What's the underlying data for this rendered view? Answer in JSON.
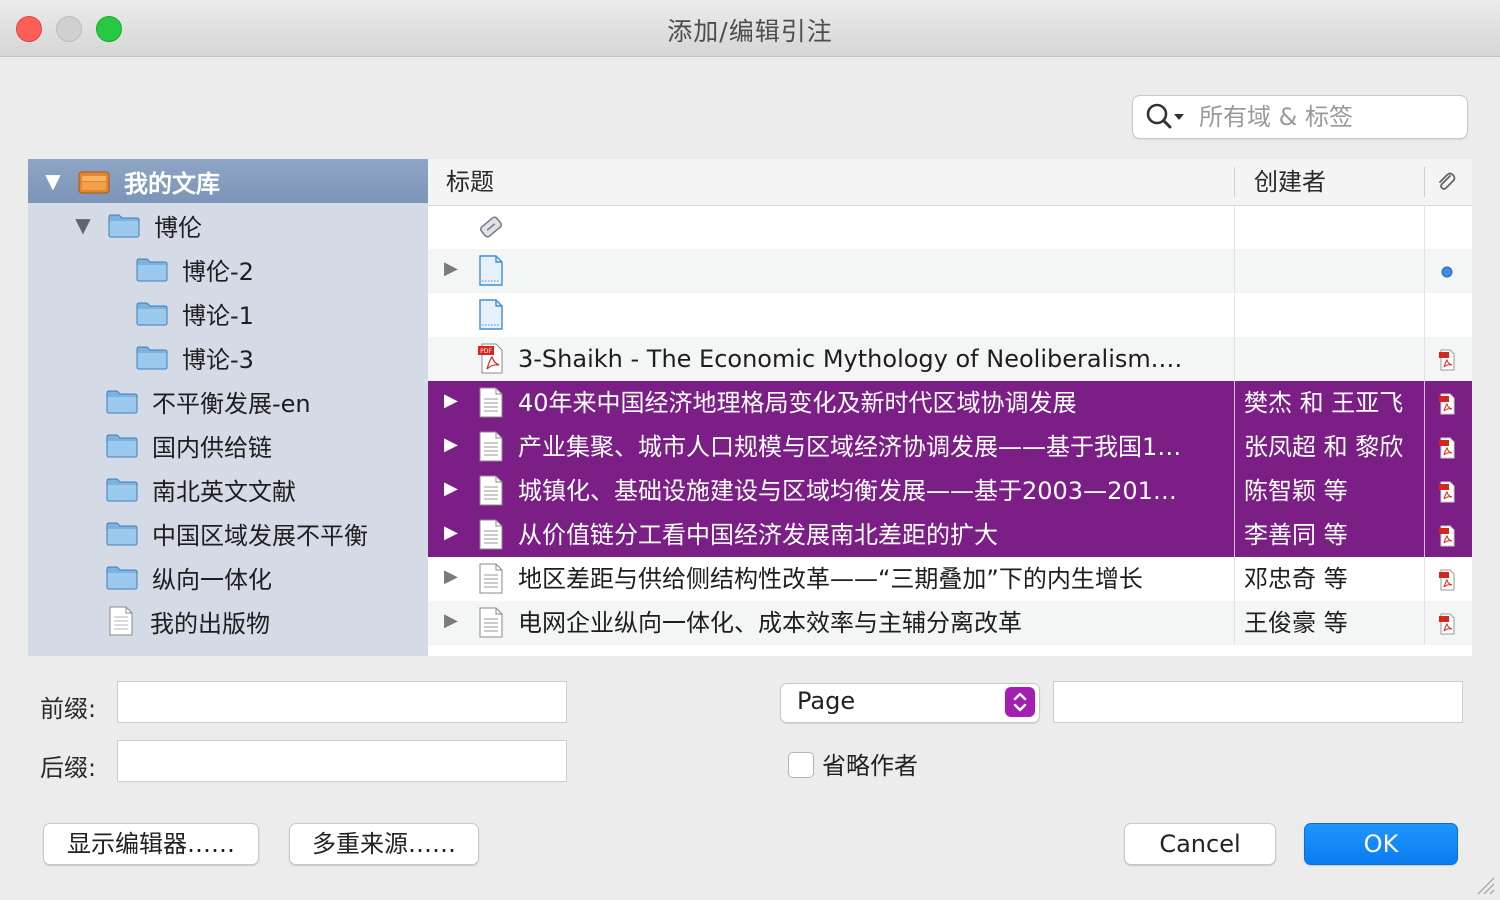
{
  "window": {
    "title": "添加/编辑引注"
  },
  "search": {
    "placeholder": "所有域 & 标签",
    "icon": "search-icon"
  },
  "sidebar": {
    "items": [
      {
        "label": "我的文库",
        "icon": "library-icon",
        "level": 0,
        "expanded": true,
        "selected": true
      },
      {
        "label": "博伦",
        "icon": "folder-icon",
        "level": 1,
        "expanded": true
      },
      {
        "label": "博伦-2",
        "icon": "folder-icon",
        "level": 2
      },
      {
        "label": "博论-1",
        "icon": "folder-icon",
        "level": 2
      },
      {
        "label": "博论-3",
        "icon": "folder-icon",
        "level": 2
      },
      {
        "label": "不平衡发展-en",
        "icon": "folder-icon",
        "level": 1
      },
      {
        "label": "国内供给链",
        "icon": "folder-icon",
        "level": 1
      },
      {
        "label": "南北英文文献",
        "icon": "folder-icon",
        "level": 1
      },
      {
        "label": "中国区域发展不平衡",
        "icon": "folder-icon",
        "level": 1
      },
      {
        "label": "纵向一体化",
        "icon": "folder-icon",
        "level": 1
      },
      {
        "label": "我的出版物",
        "icon": "document-icon",
        "level": 1
      }
    ]
  },
  "table": {
    "columns": {
      "title": "标题",
      "creator": "创建者",
      "attachment_icon": "paperclip-icon"
    },
    "rows": [
      {
        "title": "",
        "creator": "",
        "icon": "link-icon",
        "expandable": false,
        "attachment": "",
        "selected": false
      },
      {
        "title": "",
        "creator": "",
        "icon": "web-page-icon",
        "expandable": true,
        "attachment": "dot",
        "selected": false
      },
      {
        "title": "",
        "creator": "",
        "icon": "web-page-icon",
        "expandable": false,
        "attachment": "",
        "selected": false
      },
      {
        "title": "3-Shaikh - The Economic Mythology of Neoliberalism.…",
        "creator": "",
        "icon": "pdf-icon",
        "expandable": false,
        "attachment": "pdf",
        "selected": false
      },
      {
        "title": "40年来中国经济地理格局变化及新时代区域协调发展",
        "creator": "樊杰 和 王亚飞",
        "icon": "article-icon",
        "expandable": true,
        "attachment": "pdf",
        "selected": true
      },
      {
        "title": "产业集聚、城市人口规模与区域经济协调发展——基于我国1…",
        "creator": "张凤超 和 黎欣",
        "icon": "article-icon",
        "expandable": true,
        "attachment": "pdf",
        "selected": true
      },
      {
        "title": "城镇化、基础设施建设与区域均衡发展——基于2003—201…",
        "creator": "陈智颖 等",
        "icon": "article-icon",
        "expandable": true,
        "attachment": "pdf",
        "selected": true
      },
      {
        "title": "从价值链分工看中国经济发展南北差距的扩大",
        "creator": "李善同 等",
        "icon": "article-icon",
        "expandable": true,
        "attachment": "pdf",
        "selected": true
      },
      {
        "title": "地区差距与供给侧结构性改革——“三期叠加”下的内生增长",
        "creator": "邓忠奇 等",
        "icon": "article-icon",
        "expandable": true,
        "attachment": "pdf",
        "selected": false
      },
      {
        "title": "电网企业纵向一体化、成本效率与主辅分离改革",
        "creator": "王俊豪 等",
        "icon": "article-icon",
        "expandable": true,
        "attachment": "pdf",
        "selected": false
      }
    ]
  },
  "form": {
    "prefix_label": "前缀:",
    "prefix_value": "",
    "suffix_label": "后缀:",
    "suffix_value": "",
    "locator_select": "Page",
    "locator_value": "",
    "omit_author_label": "省略作者",
    "omit_author_checked": false
  },
  "buttons": {
    "show_editor": "显示编辑器……",
    "multiple_sources": "多重来源……",
    "cancel": "Cancel",
    "ok": "OK"
  },
  "colors": {
    "selection": "#7b1f86",
    "sidebar_bg": "#d4dbe6",
    "sidebar_selected": "#8ea5c5",
    "primary_button": "#0a7cf0",
    "stepper_accent": "#a41eb1"
  }
}
